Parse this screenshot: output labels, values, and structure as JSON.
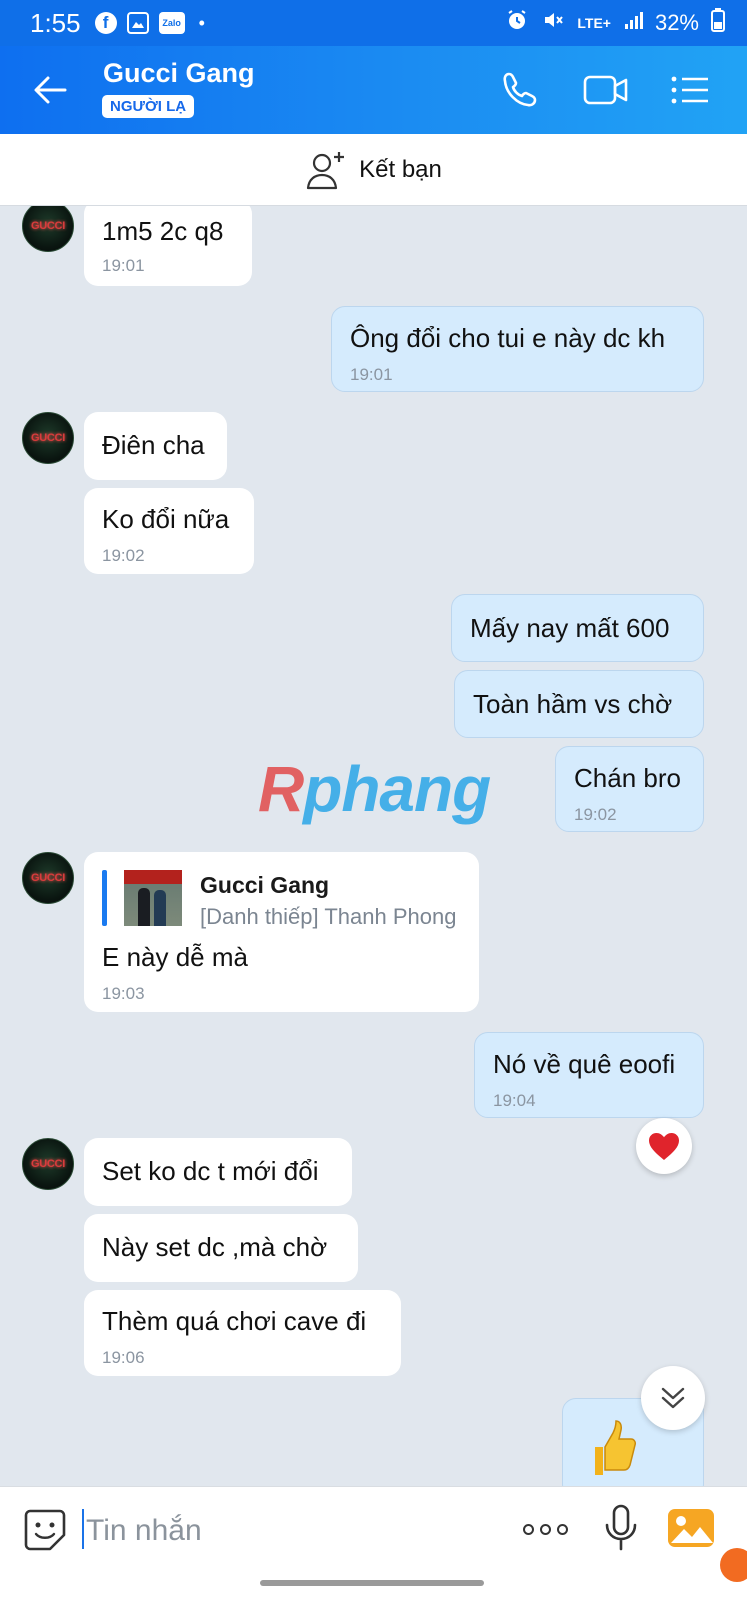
{
  "status_bar": {
    "time": "1:55",
    "zalo_icon_text": "Zalo",
    "network": "LTE+",
    "battery": "32%",
    "icons": [
      "facebook-icon",
      "gallery-icon",
      "zalo-icon",
      "alarm-icon",
      "mute-icon",
      "signal-icon",
      "battery-icon"
    ]
  },
  "header": {
    "title": "Gucci Gang",
    "badge": "NGƯỜI LẠ",
    "icons": [
      "back-arrow-icon",
      "phone-icon",
      "video-call-icon",
      "menu-list-icon"
    ]
  },
  "add_friend": {
    "label": "Kết bạn"
  },
  "watermark": {
    "part1": "R",
    "part2": "phang"
  },
  "avatar_text": "GUCCI",
  "messages": [
    {
      "dir": "in",
      "text": "1m5 2c q8",
      "time": "19:01"
    },
    {
      "dir": "out",
      "text": "Ông đổi cho tui e này dc kh",
      "time": "19:01"
    },
    {
      "dir": "in",
      "text": "Điên cha",
      "time": ""
    },
    {
      "dir": "in",
      "text": "Ko đổi nữa",
      "time": "19:02"
    },
    {
      "dir": "out",
      "text": "Mấy nay mất 600",
      "time": ""
    },
    {
      "dir": "out",
      "text": "Toàn hầm vs chờ",
      "time": ""
    },
    {
      "dir": "out",
      "text": "Chán bro",
      "time": "19:02"
    },
    {
      "dir": "in",
      "type": "card",
      "card_name": "Gucci Gang",
      "card_sub": "[Danh thiếp] Thanh Phong",
      "text": "E này dễ mà",
      "time": "19:03"
    },
    {
      "dir": "out",
      "text": "Nó về quê eoofi",
      "time": "19:04",
      "reaction": "heart"
    },
    {
      "dir": "in",
      "text": "Set ko dc t mới đổi",
      "time": ""
    },
    {
      "dir": "in",
      "text": "Này set dc ,mà chờ",
      "time": ""
    },
    {
      "dir": "in",
      "text": "Thèm quá chơi cave đi",
      "time": "19:06"
    },
    {
      "dir": "out",
      "type": "sticker",
      "sticker": "thumbs-up"
    }
  ],
  "composer": {
    "placeholder": "Tin nhắn",
    "value": "",
    "icons": [
      "sticker-icon",
      "more-dots-icon",
      "microphone-icon",
      "photo-icon"
    ]
  },
  "colors": {
    "header_start": "#0e6ff0",
    "header_end": "#21a3f5",
    "chat_bg": "#e1e7ee",
    "outgoing_bubble": "#d5ebfd",
    "incoming_bubble": "#ffffff",
    "heart": "#e0242c"
  }
}
